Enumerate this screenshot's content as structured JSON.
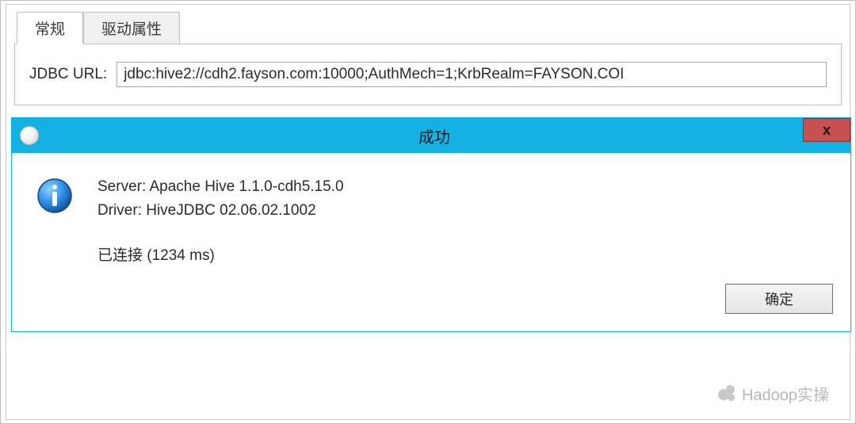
{
  "tabs": {
    "general": "常规",
    "driverProps": "驱动属性"
  },
  "main": {
    "jdbcLabel": "JDBC URL:",
    "jdbcValue": "jdbc:hive2://cdh2.fayson.com:10000;AuthMech=1;KrbRealm=FAYSON.COI"
  },
  "dialog": {
    "title": "成功",
    "closeGlyph": "x",
    "lines": {
      "server": "Server: Apache Hive 1.1.0-cdh5.15.0",
      "driver": "Driver: HiveJDBC 02.06.02.1002",
      "connected": "已连接 (1234 ms)"
    },
    "ok": "确定"
  },
  "watermark": "Hadoop实操"
}
